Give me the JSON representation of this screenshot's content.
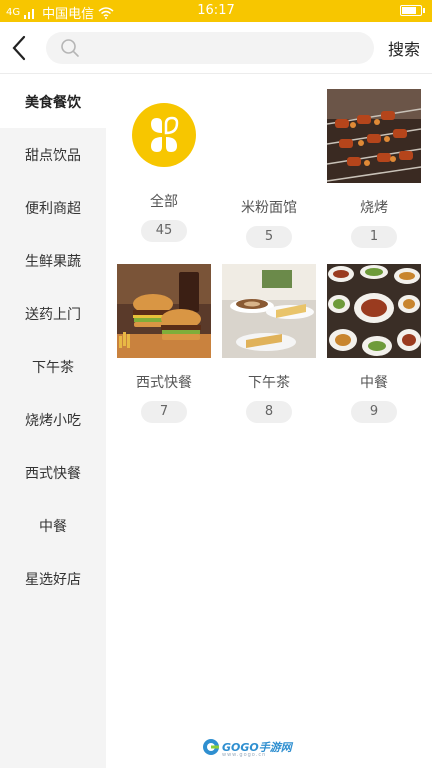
{
  "status_bar": {
    "carrier": "中国电信",
    "signal_prefix": "4G",
    "time": "16:17",
    "battery_level": 0.85
  },
  "header": {
    "back_icon": "chevron-left-icon",
    "search_placeholder": "",
    "search_label": "搜索"
  },
  "sidebar": {
    "items": [
      {
        "label": "美食餐饮",
        "active": true
      },
      {
        "label": "甜点饮品"
      },
      {
        "label": "便利商超"
      },
      {
        "label": "生鲜果蔬"
      },
      {
        "label": "送药上门"
      },
      {
        "label": "下午茶"
      },
      {
        "label": "烧烤小吃"
      },
      {
        "label": "西式快餐"
      },
      {
        "label": "中餐"
      },
      {
        "label": "星选好店"
      }
    ]
  },
  "grid": [
    {
      "name": "全部",
      "count": "45",
      "icon": "clover-icon"
    },
    {
      "name": "米粉面馆",
      "count": "5"
    },
    {
      "name": "烧烤",
      "count": "1",
      "image": "bbq-skewers-photo"
    },
    {
      "name": "西式快餐",
      "count": "7",
      "image": "burgers-photo"
    },
    {
      "name": "下午茶",
      "count": "8",
      "image": "coffee-cake-photo"
    },
    {
      "name": "中餐",
      "count": "9",
      "image": "chinese-dishes-photo"
    }
  ],
  "watermark": {
    "brand": "GOGO手游网",
    "url": "www.gogo.cn"
  },
  "colors": {
    "accent": "#f7c600",
    "sidebar_bg": "#f4f4f4",
    "pill_bg": "#efefef"
  }
}
